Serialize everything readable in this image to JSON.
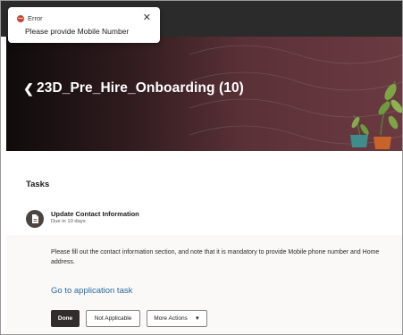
{
  "toast": {
    "kind": "Error",
    "message": "Please provide Mobile Number",
    "close_icon": "close-icon",
    "status_icon": "error-icon"
  },
  "header": {
    "back_icon": "chevron-left-icon",
    "title": "23D_Pre_Hire_Onboarding (10)"
  },
  "tasks": {
    "heading": "Tasks",
    "items": [
      {
        "title": "Update Contact Information",
        "due": "Due in 10 days",
        "icon": "document-icon",
        "description": "Please fill out the contact information section, and note that it is mandatory to provide Mobile phone number and Home address.",
        "link_label": "Go to application task",
        "actions": {
          "done_label": "Done",
          "not_applicable_label": "Not Applicable",
          "more_actions_label": "More Actions"
        }
      }
    ]
  },
  "colors": {
    "accent_link": "#2a6aa0",
    "error": "#c74634",
    "primary_button": "#312d2a"
  }
}
